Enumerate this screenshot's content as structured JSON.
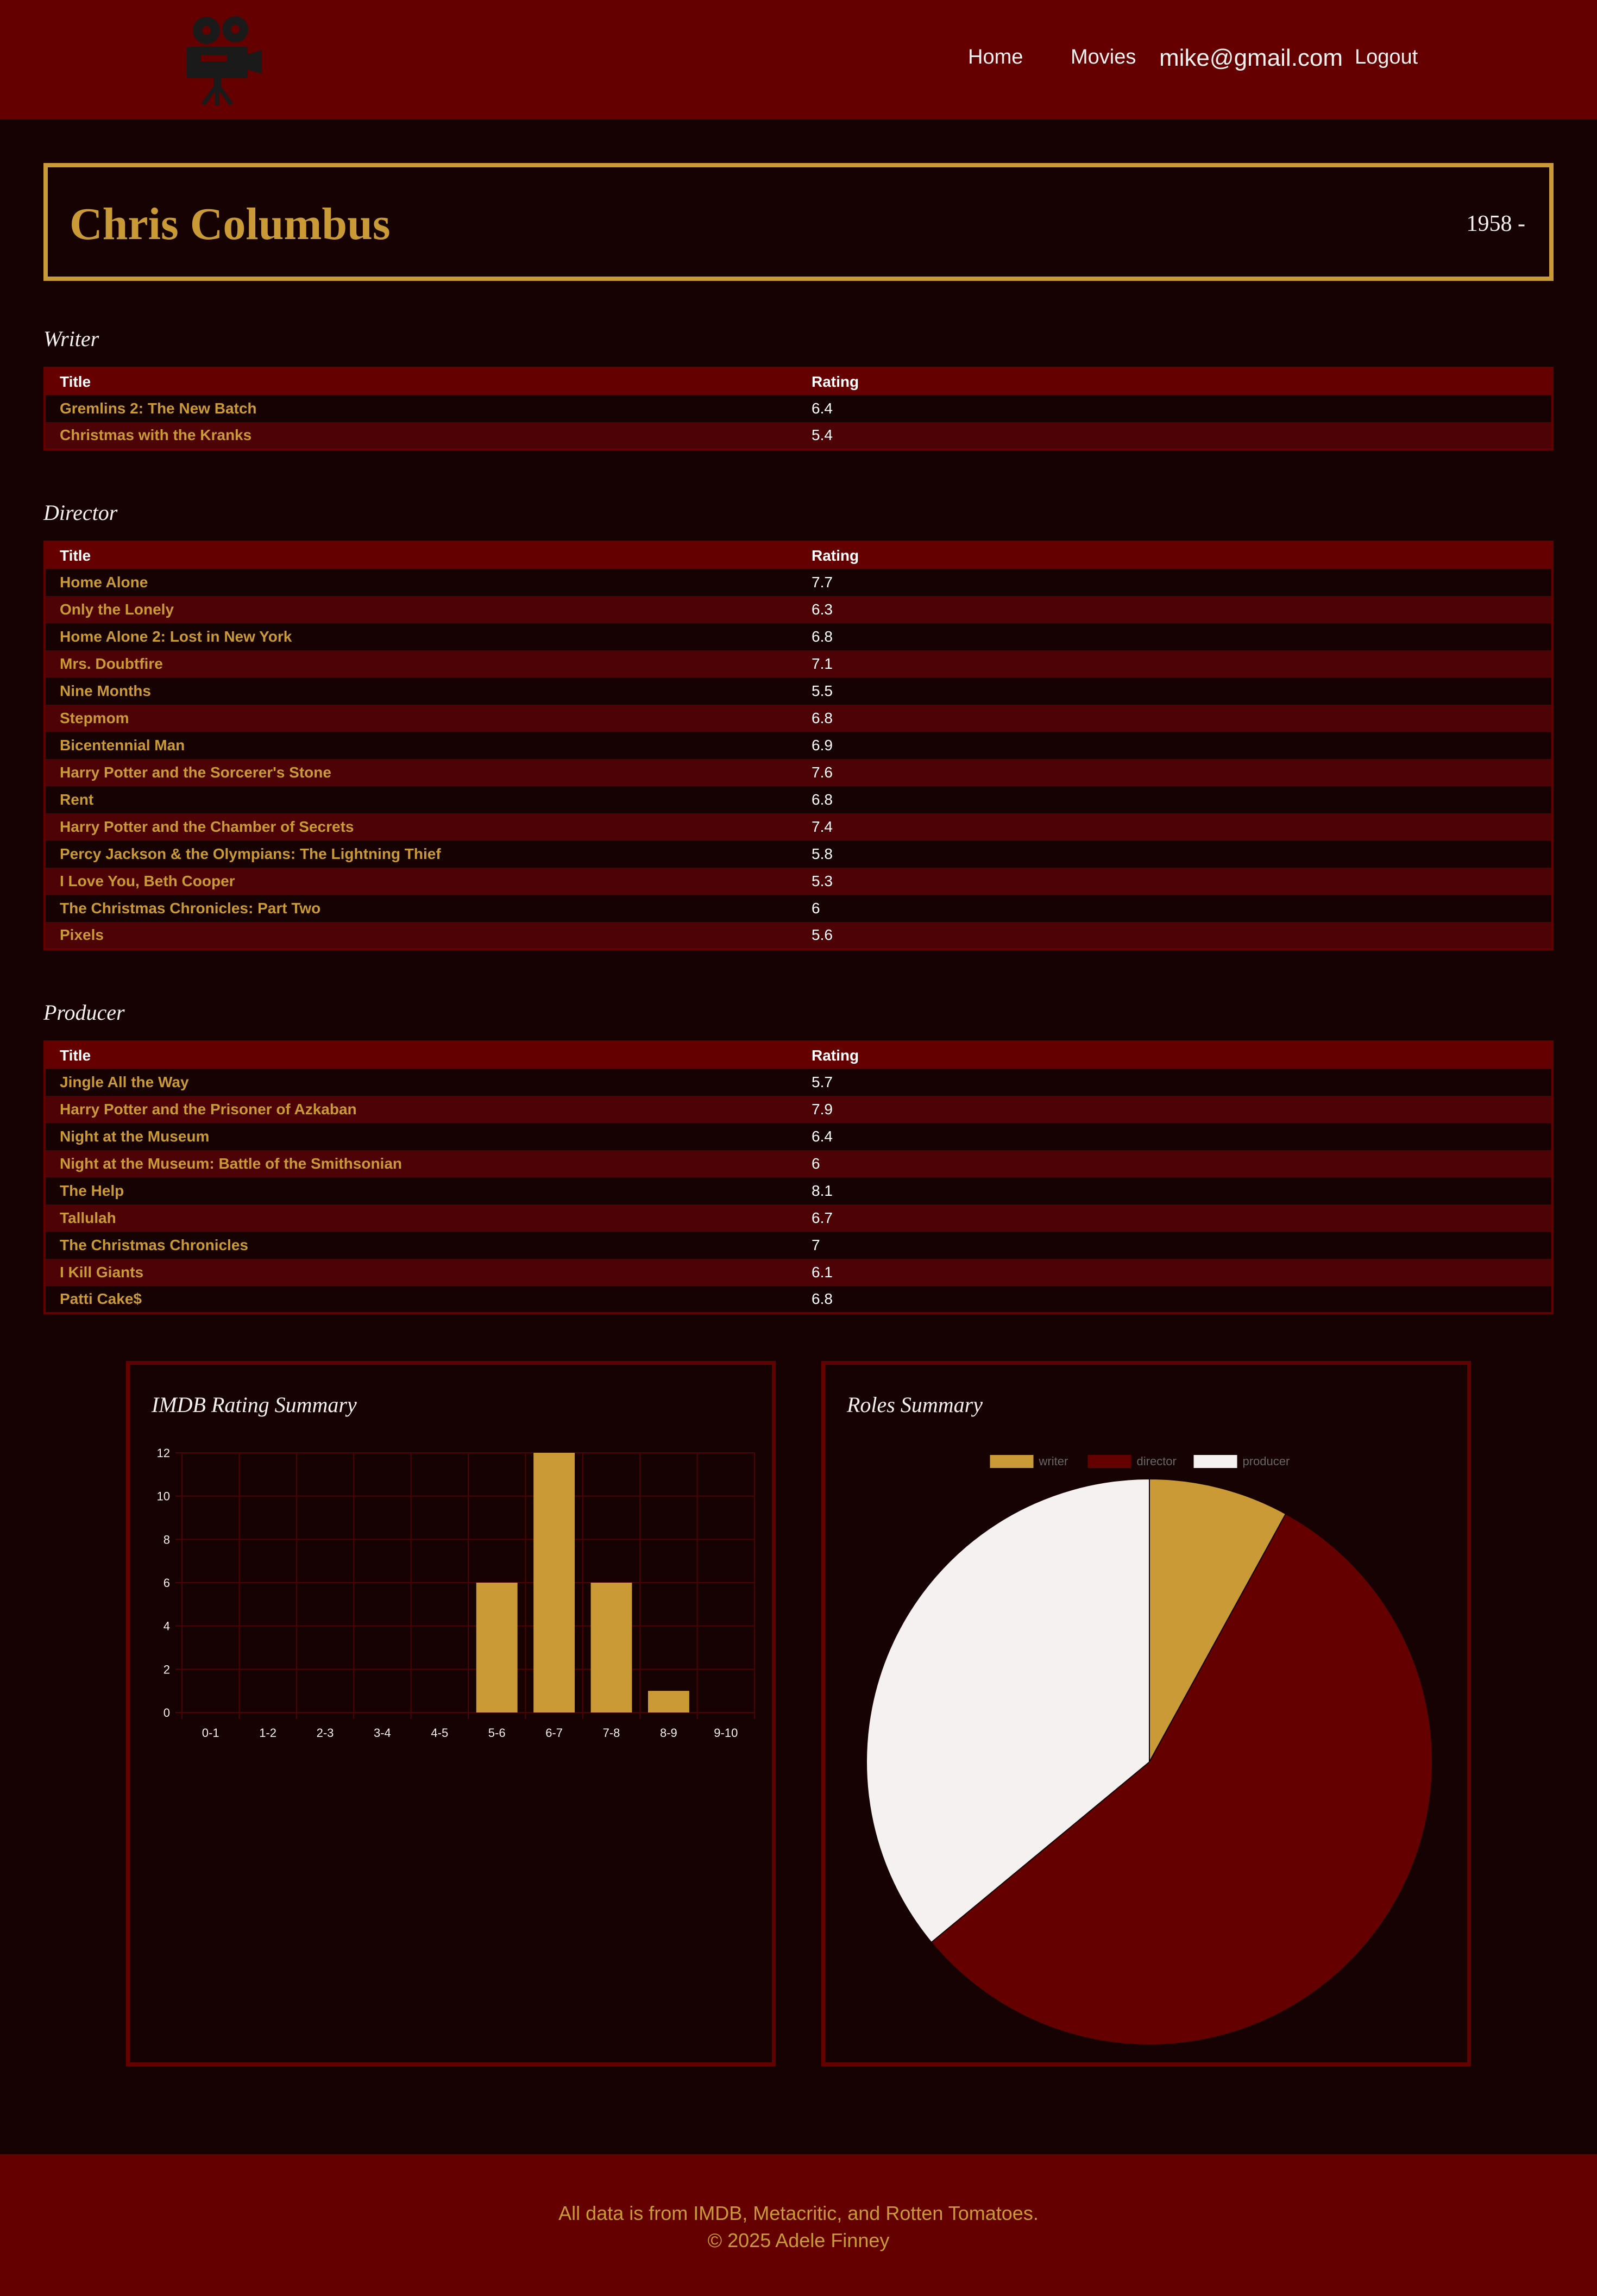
{
  "nav": {
    "logo_icon": "film-camera-icon",
    "home": "Home",
    "movies": "Movies",
    "email": "mike@gmail.com",
    "logout": "Logout"
  },
  "person": {
    "name": "Chris Columbus",
    "years": "1958 -"
  },
  "table_headers": {
    "title": "Title",
    "rating": "Rating"
  },
  "writer": {
    "heading": "Writer",
    "rows": [
      {
        "title": "Gremlins 2: The New Batch",
        "rating": "6.4"
      },
      {
        "title": "Christmas with the Kranks",
        "rating": "5.4"
      }
    ]
  },
  "director": {
    "heading": "Director",
    "rows": [
      {
        "title": "Home Alone",
        "rating": "7.7"
      },
      {
        "title": "Only the Lonely",
        "rating": "6.3"
      },
      {
        "title": "Home Alone 2: Lost in New York",
        "rating": "6.8"
      },
      {
        "title": "Mrs. Doubtfire",
        "rating": "7.1"
      },
      {
        "title": "Nine Months",
        "rating": "5.5"
      },
      {
        "title": "Stepmom",
        "rating": "6.8"
      },
      {
        "title": "Bicentennial Man",
        "rating": "6.9"
      },
      {
        "title": "Harry Potter and the Sorcerer's Stone",
        "rating": "7.6"
      },
      {
        "title": "Rent",
        "rating": "6.8"
      },
      {
        "title": "Harry Potter and the Chamber of Secrets",
        "rating": "7.4"
      },
      {
        "title": "Percy Jackson & the Olympians: The Lightning Thief",
        "rating": "5.8"
      },
      {
        "title": "I Love You, Beth Cooper",
        "rating": "5.3"
      },
      {
        "title": "The Christmas Chronicles: Part Two",
        "rating": "6"
      },
      {
        "title": "Pixels",
        "rating": "5.6"
      }
    ]
  },
  "producer": {
    "heading": "Producer",
    "rows": [
      {
        "title": "Jingle All the Way",
        "rating": "5.7"
      },
      {
        "title": "Harry Potter and the Prisoner of Azkaban",
        "rating": "7.9"
      },
      {
        "title": "Night at the Museum",
        "rating": "6.4"
      },
      {
        "title": "Night at the Museum: Battle of the Smithsonian",
        "rating": "6"
      },
      {
        "title": "The Help",
        "rating": "8.1"
      },
      {
        "title": "Tallulah",
        "rating": "6.7"
      },
      {
        "title": "The Christmas Chronicles",
        "rating": "7"
      },
      {
        "title": "I Kill Giants",
        "rating": "6.1"
      },
      {
        "title": "Patti Cake$",
        "rating": "6.8"
      }
    ]
  },
  "colors": {
    "brand_red": "#650000",
    "gold": "#c99a35",
    "background": "#160203",
    "row_alt": "#4d0305",
    "offwhite": "#f4f1f0"
  },
  "chart_data": [
    {
      "type": "bar",
      "title": "IMDB Rating Summary",
      "categories": [
        "0-1",
        "1-2",
        "2-3",
        "3-4",
        "4-5",
        "5-6",
        "6-7",
        "7-8",
        "8-9",
        "9-10"
      ],
      "values": [
        0,
        0,
        0,
        0,
        0,
        6,
        12,
        6,
        1,
        0
      ],
      "ylim": [
        0,
        12
      ],
      "yticks": [
        0,
        2,
        4,
        6,
        8,
        10,
        12
      ],
      "xlabel": "",
      "ylabel": "",
      "grid": true,
      "color": "#c99a35"
    },
    {
      "type": "pie",
      "title": "Roles Summary",
      "labels": [
        "writer",
        "director",
        "producer"
      ],
      "values": [
        2,
        14,
        9
      ],
      "colors": [
        "#c99a35",
        "#650000",
        "#f4f1f0"
      ],
      "legend": "top"
    }
  ],
  "footer": {
    "line1": "All data is from IMDB, Metacritic, and Rotten Tomatoes.",
    "line2": "© 2025 Adele Finney"
  }
}
